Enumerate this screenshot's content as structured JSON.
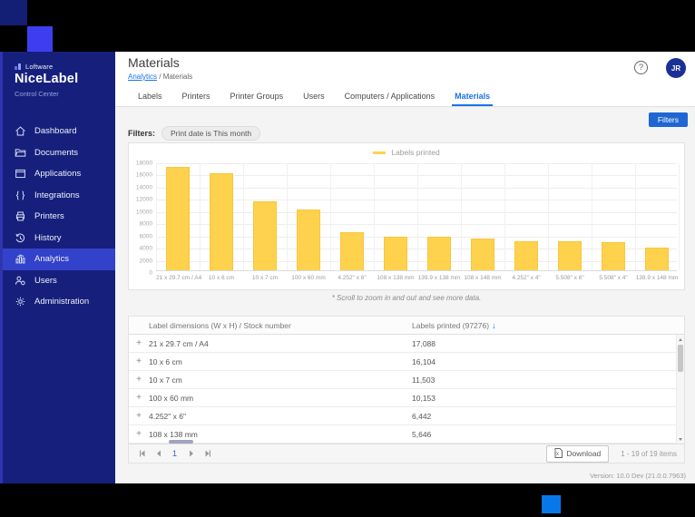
{
  "logo": {
    "brand": "Loftware",
    "product": "NiceLabel",
    "subtitle": "Control Center"
  },
  "sidebar": {
    "items": [
      {
        "label": "Dashboard",
        "icon": "home",
        "selected": false
      },
      {
        "label": "Documents",
        "icon": "folder",
        "selected": false
      },
      {
        "label": "Applications",
        "icon": "window",
        "selected": false
      },
      {
        "label": "Integrations",
        "icon": "braces",
        "selected": false
      },
      {
        "label": "Printers",
        "icon": "printer",
        "selected": false
      },
      {
        "label": "History",
        "icon": "history",
        "selected": false
      },
      {
        "label": "Analytics",
        "icon": "chart",
        "selected": true
      },
      {
        "label": "Users",
        "icon": "users",
        "selected": false
      },
      {
        "label": "Administration",
        "icon": "gear",
        "selected": false
      }
    ]
  },
  "header": {
    "title": "Materials",
    "breadcrumb_parent": "Analytics",
    "breadcrumb_separator": " / ",
    "breadcrumb_current": "Materials",
    "help_glyph": "?",
    "avatar_initials": "JR"
  },
  "tabs": {
    "items": [
      "Labels",
      "Printers",
      "Printer Groups",
      "Users",
      "Computers / Applications",
      "Materials"
    ],
    "active": "Materials"
  },
  "filters": {
    "label": "Filters:",
    "chip": "Print date is This month",
    "button": "Filters"
  },
  "chart_data": {
    "type": "bar",
    "title": "",
    "legend": [
      "Labels printed"
    ],
    "legend_position": "top",
    "categories": [
      "21 x 29.7 cm / A4",
      "10 x 6 cm",
      "10 x 7 cm",
      "100 x 60 mm",
      "4.252\" x 6\"",
      "108 x 138 mm",
      "139.9 x 138 mm",
      "108 x 148 mm",
      "4.252\" x 4\"",
      "5.508\" x 6\"",
      "5.508\" x 4\"",
      "139.9 x 148 mm"
    ],
    "values": [
      17088,
      16104,
      11503,
      10153,
      6442,
      5646,
      5600,
      5300,
      4850,
      4850,
      4700,
      3900
    ],
    "xlabel": "",
    "ylabel": "",
    "ylim": [
      0,
      18000
    ],
    "ytick_step": 2000,
    "grid": true,
    "bar_color": "#ffd24d"
  },
  "chart_note": "* Scroll to zoom in and out and see more data.",
  "table": {
    "col_dimensions": "Label dimensions (W x H) / Stock number",
    "col_printed": "Labels printed (97276)",
    "sort_icon": "↓",
    "expand_glyph": "+",
    "rows": [
      {
        "dimensions": "21 x 29.7 cm / A4",
        "printed": "17,088"
      },
      {
        "dimensions": "10 x 6 cm",
        "printed": "16,104"
      },
      {
        "dimensions": "10 x 7 cm",
        "printed": "11,503"
      },
      {
        "dimensions": "100 x 60 mm",
        "printed": "10,153"
      },
      {
        "dimensions": "4.252\" x 6\"",
        "printed": "6,442"
      },
      {
        "dimensions": "108 x 138 mm",
        "printed": "5,646"
      }
    ]
  },
  "pagination": {
    "page": "1",
    "download_label": "Download",
    "items_range": "1 - 19 of 19 items"
  },
  "footer": {
    "version": "Version: 10.0 Dev (21.0.0.7963)"
  }
}
